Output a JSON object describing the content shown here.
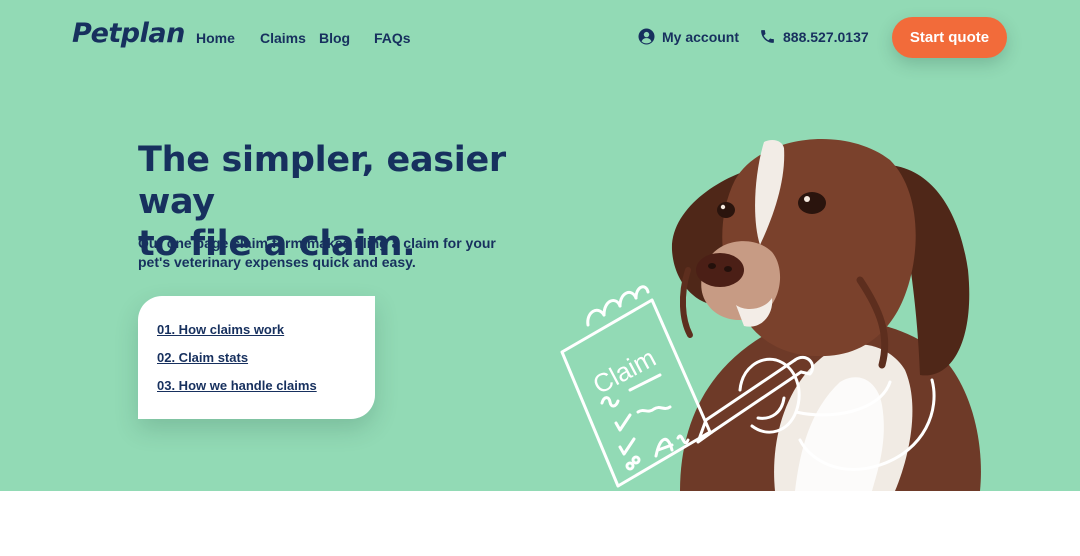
{
  "brand": {
    "logo_text": "Petplan"
  },
  "nav": {
    "items": [
      {
        "label": "Home"
      },
      {
        "label": "Claims"
      },
      {
        "label": "Blog"
      },
      {
        "label": "FAQs"
      }
    ]
  },
  "header": {
    "account_label": "My account",
    "phone_label": "888.527.0137",
    "cta_label": "Start quote"
  },
  "hero": {
    "title_line1": "The simpler, easier way",
    "title_line2": "to file a claim.",
    "subtitle": "Our one page claim form makes filing a claim for your pet's veterinary expenses quick and easy.",
    "links": [
      {
        "label": "01. How claims work"
      },
      {
        "label": "02. Claim stats"
      },
      {
        "label": "03. How we handle claims"
      }
    ],
    "illustration_text": "Claim"
  },
  "colors": {
    "hero_background": "#92dab5",
    "navy": "#17305e",
    "cta": "#f26b3a",
    "card": "#ffffff"
  },
  "icons": {
    "account": "user-circle-icon",
    "phone": "phone-icon"
  }
}
